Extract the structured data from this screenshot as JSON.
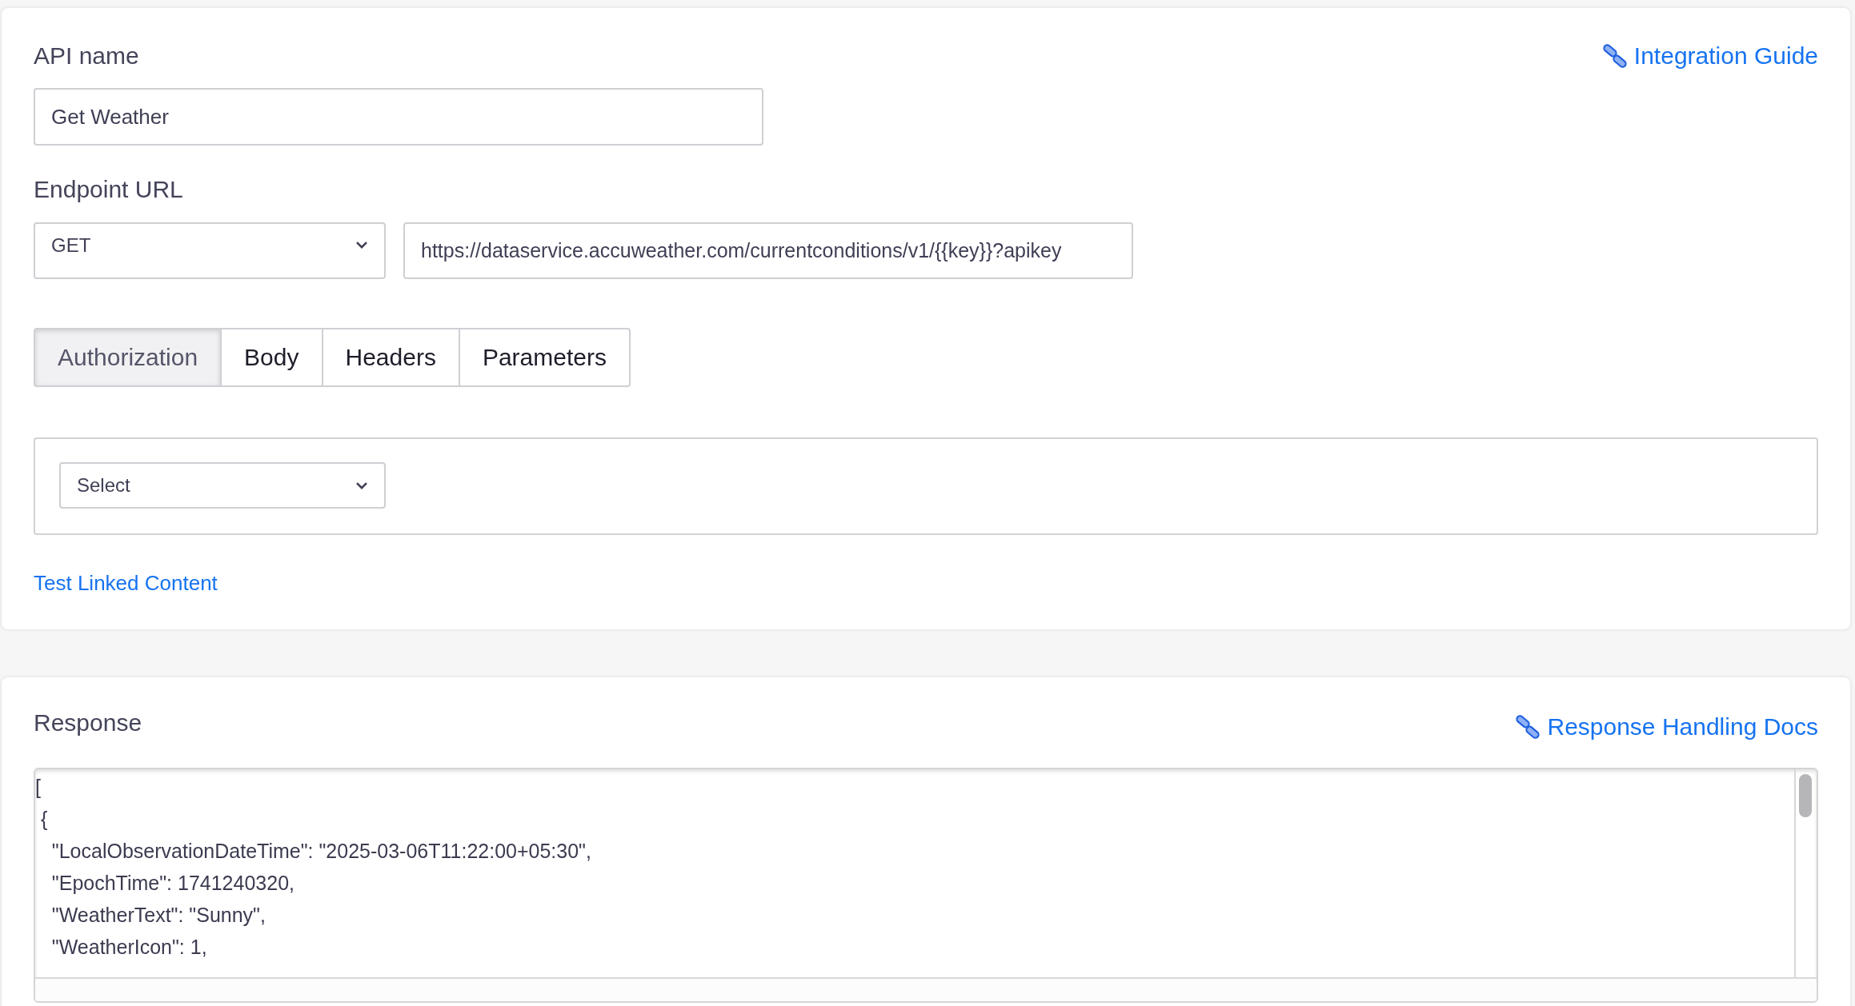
{
  "api_name": {
    "label": "API name",
    "value": "Get Weather"
  },
  "integration_link": "Integration Guide",
  "endpoint": {
    "label": "Endpoint URL",
    "method": "GET",
    "url": "https://dataservice.accuweather.com/currentconditions/v1/{{key}}?apikey"
  },
  "tabs": [
    {
      "label": "Authorization",
      "selected": true
    },
    {
      "label": "Body",
      "selected": false
    },
    {
      "label": "Headers",
      "selected": false
    },
    {
      "label": "Parameters",
      "selected": false
    }
  ],
  "auth": {
    "select": "Select"
  },
  "test_link": "Test Linked Content",
  "response": {
    "title": "Response",
    "docs_link": "Response Handling Docs",
    "lines": [
      "[",
      " {",
      "   \"LocalObservationDateTime\": \"2025-03-06T11:22:00+05:30\",",
      "   \"EpochTime\": 1741240320,",
      "   \"WeatherText\": \"Sunny\",",
      "   \"WeatherIcon\": 1,"
    ]
  }
}
